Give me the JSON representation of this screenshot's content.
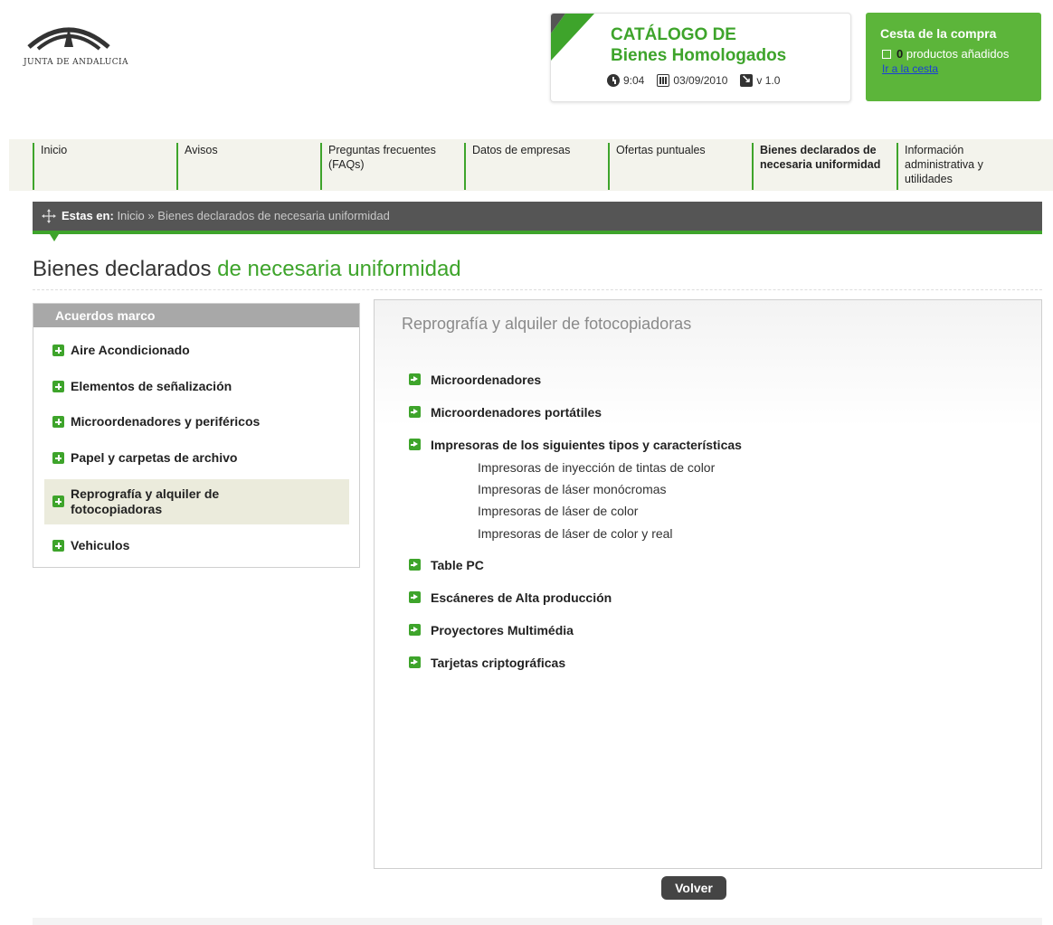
{
  "header": {
    "logo_text": "JUNTA DE ANDALUCIA",
    "catalog": {
      "title_line1": "CATÁLOGO DE",
      "title_line2": "Bienes Homologados",
      "time": "9:04",
      "date": "03/09/2010",
      "version": "v 1.0"
    },
    "cart": {
      "title": "Cesta de la compra",
      "count": "0",
      "count_label": "productos añadidos",
      "link": "Ir a la cesta"
    }
  },
  "nav": {
    "items": [
      {
        "label": "Inicio"
      },
      {
        "label": "Avisos"
      },
      {
        "label": "Preguntas frecuentes (FAQs)"
      },
      {
        "label": "Datos de empresas"
      },
      {
        "label": "Ofertas puntuales"
      },
      {
        "label": "Bienes declarados de necesaria uniformidad"
      },
      {
        "label": "Información administrativa y utilidades"
      }
    ],
    "active_index": 5
  },
  "breadcrumb": {
    "label": "Estas en:",
    "home": "Inicio",
    "separator": "»",
    "current": "Bienes declarados de necesaria uniformidad"
  },
  "page": {
    "title_part1": "Bienes declarados",
    "title_part2": "de necesaria uniformidad"
  },
  "sidebar": {
    "heading": "Acuerdos marco",
    "items": [
      {
        "label": "Aire Acondicionado"
      },
      {
        "label": "Elementos de señalización"
      },
      {
        "label": "Microordenadores y periféricos"
      },
      {
        "label": "Papel y carpetas de archivo"
      },
      {
        "label": "Reprografía y alquiler de fotocopiadoras"
      },
      {
        "label": "Vehiculos"
      }
    ],
    "active_index": 4
  },
  "main": {
    "title": "Reprografía y alquiler de fotocopiadoras",
    "items": [
      {
        "label": "Microordenadores"
      },
      {
        "label": "Microordenadores portátiles"
      },
      {
        "label": "Impresoras de los siguientes tipos y características"
      },
      {
        "label": "Table PC"
      },
      {
        "label": "Escáneres de Alta producción"
      },
      {
        "label": "Proyectores Multimédia"
      },
      {
        "label": "Tarjetas criptográficas"
      }
    ],
    "subitems": [
      "Impresoras de inyección de tintas de color",
      "Impresoras de láser monócromas",
      "Impresoras de láser de color",
      "Impresoras de láser de color y real"
    ],
    "back_button": "Volver"
  },
  "colors": {
    "brand_green": "#3ea42b",
    "cart_green": "#5cb53a",
    "breadcrumb_bg": "#555555"
  }
}
